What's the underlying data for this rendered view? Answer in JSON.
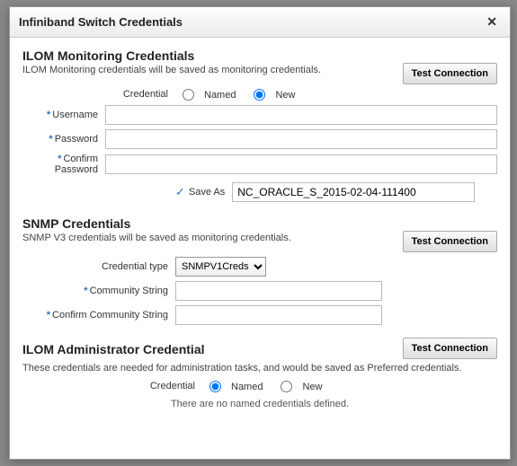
{
  "title": "Infiniband Switch Credentials",
  "buttons": {
    "test_connection": "Test Connection"
  },
  "ilom_monitoring": {
    "title": "ILOM Monitoring Credentials",
    "desc": "ILOM Monitoring credentials will be saved as monitoring credentials.",
    "credential_label": "Credential",
    "named_label": "Named",
    "new_label": "New",
    "username_label": "Username",
    "password_label": "Password",
    "confirm_password_label": "Confirm Password",
    "username_value": "",
    "password_value": "",
    "confirm_password_value": "",
    "save_as_label": "Save As",
    "save_as_value": "NC_ORACLE_S_2015-02-04-111400"
  },
  "snmp": {
    "title": "SNMP Credentials",
    "desc": "SNMP V3 credentials will be saved as monitoring credentials.",
    "credential_type_label": "Credential type",
    "credential_type_value": "SNMPV1Creds",
    "community_string_label": "Community String",
    "confirm_community_string_label": "Confirm Community String",
    "community_string_value": "",
    "confirm_community_string_value": ""
  },
  "ilom_admin": {
    "title": "ILOM Administrator Credential",
    "desc": "These credentials are needed for administration tasks, and would be saved as Preferred credentials.",
    "credential_label": "Credential",
    "named_label": "Named",
    "new_label": "New",
    "info": "There are no named credentials defined."
  }
}
